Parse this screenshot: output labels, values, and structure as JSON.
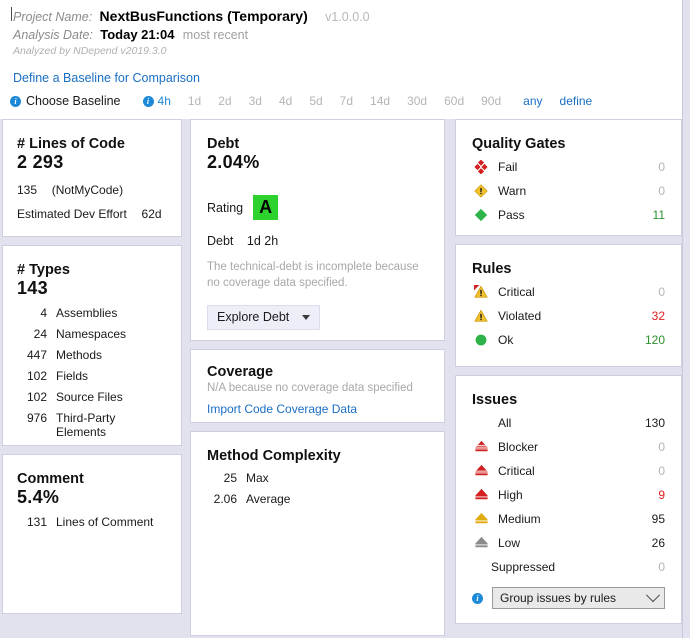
{
  "header": {
    "project_label": "Project Name:",
    "project_name": "NextBusFunctions (Temporary)",
    "version": "v1.0.0.0",
    "analysis_label": "Analysis Date:",
    "analysis_date": "Today 21:04",
    "analysis_suffix": "most recent",
    "analyzed_by": "Analyzed by NDepend v2019.3.0",
    "baseline_link": "Define a Baseline for Comparison",
    "choose_baseline": "Choose Baseline",
    "ranges": [
      {
        "label": "4h",
        "state": "active"
      },
      {
        "label": "1d",
        "state": "muted"
      },
      {
        "label": "2d",
        "state": "muted"
      },
      {
        "label": "3d",
        "state": "muted"
      },
      {
        "label": "4d",
        "state": "muted"
      },
      {
        "label": "5d",
        "state": "muted"
      },
      {
        "label": "7d",
        "state": "muted"
      },
      {
        "label": "14d",
        "state": "muted"
      },
      {
        "label": "30d",
        "state": "muted"
      },
      {
        "label": "60d",
        "state": "muted"
      },
      {
        "label": "90d",
        "state": "muted"
      },
      {
        "label": "any",
        "state": "link"
      },
      {
        "label": "define",
        "state": "link"
      }
    ]
  },
  "lines_of_code": {
    "title": "# Lines of Code",
    "value": "2 293",
    "notmycode_value": "135",
    "notmycode_label": "(NotMyCode)",
    "effort_label": "Estimated Dev Effort",
    "effort_value": "62d"
  },
  "types": {
    "title": "# Types",
    "value": "143",
    "rows": [
      {
        "num": "4",
        "label": "Assemblies"
      },
      {
        "num": "24",
        "label": "Namespaces"
      },
      {
        "num": "447",
        "label": "Methods"
      },
      {
        "num": "102",
        "label": "Fields"
      },
      {
        "num": "102",
        "label": "Source Files"
      },
      {
        "num": "976",
        "label": "Third-Party Elements"
      }
    ]
  },
  "comment": {
    "title": "Comment",
    "value": "5.4%",
    "rows": [
      {
        "num": "131",
        "label": "Lines of Comment"
      }
    ]
  },
  "debt": {
    "title": "Debt",
    "value": "2.04%",
    "rating_label": "Rating",
    "rating_value": "A",
    "rating_color": "#2ed22e",
    "debt_label": "Debt",
    "debt_value": "1d 2h",
    "note": "The technical-debt is incomplete because no coverage data specified.",
    "button_label": "Explore Debt"
  },
  "coverage": {
    "title": "Coverage",
    "na_text": "N/A because no coverage data specified",
    "link": "Import Code Coverage Data"
  },
  "method_complexity": {
    "title": "Method Complexity",
    "rows": [
      {
        "num": "25",
        "label": "Max"
      },
      {
        "num": "2.06",
        "label": "Average"
      }
    ]
  },
  "quality_gates": {
    "title": "Quality Gates",
    "rows": [
      {
        "icon": "fail-diamonds-icon",
        "label": "Fail",
        "value": "0",
        "value_style": "zero"
      },
      {
        "icon": "warn-diamond-icon",
        "label": "Warn",
        "value": "0",
        "value_style": "zero"
      },
      {
        "icon": "pass-diamond-icon",
        "label": "Pass",
        "value": "11",
        "value_style": "green"
      }
    ]
  },
  "rules": {
    "title": "Rules",
    "rows": [
      {
        "icon": "critical-warning-icon",
        "label": "Critical",
        "value": "0",
        "value_style": "zero"
      },
      {
        "icon": "warning-triangle-icon",
        "label": "Violated",
        "value": "32",
        "value_style": "red"
      },
      {
        "icon": "ok-circle-icon",
        "label": "Ok",
        "value": "120",
        "value_style": "green"
      }
    ]
  },
  "issues": {
    "title": "Issues",
    "all": {
      "label": "All",
      "value": "130"
    },
    "rows": [
      {
        "icon": "severity-blocker-icon",
        "label": "Blocker",
        "value": "0",
        "value_style": "zero"
      },
      {
        "icon": "severity-critical-icon",
        "label": "Critical",
        "value": "0",
        "value_style": "zero"
      },
      {
        "icon": "severity-high-icon",
        "label": "High",
        "value": "9",
        "value_style": "red"
      },
      {
        "icon": "severity-medium-icon",
        "label": "Medium",
        "value": "95",
        "value_style": "normal"
      },
      {
        "icon": "severity-low-icon",
        "label": "Low",
        "value": "26",
        "value_style": "normal"
      }
    ],
    "suppressed": {
      "label": "Suppressed",
      "value": "0"
    },
    "group_select": "Group issues by rules"
  },
  "colors": {
    "background": "#e2e2ee",
    "panel": "#ffffff",
    "link": "#1a6fc4",
    "info": "#1c8ad6",
    "red": "#e02020",
    "green": "#2f8f2f",
    "amber": "#e8b500"
  }
}
